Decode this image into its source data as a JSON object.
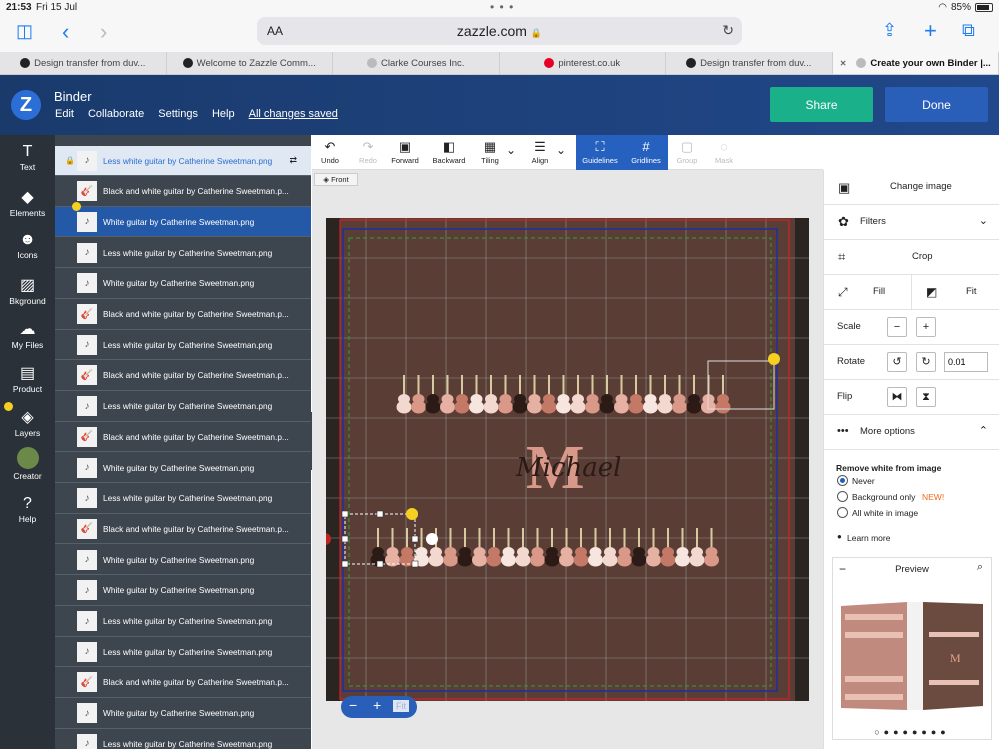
{
  "status": {
    "time": "21:53",
    "date": "Fri 15 Jul",
    "battery": "85%"
  },
  "browser": {
    "aa": "AA",
    "host": "zazzle.com",
    "lock": "🔒"
  },
  "tabs": [
    {
      "label": "Design transfer from duv...",
      "color": "#222"
    },
    {
      "label": "Welcome to Zazzle Comm...",
      "color": "#222"
    },
    {
      "label": "Clarke Courses Inc.",
      "color": "#bbb"
    },
    {
      "label": "pinterest.co.uk",
      "color": "#e60023"
    },
    {
      "label": "Design transfer from duv...",
      "color": "#222"
    },
    {
      "label": "Create your own Binder |...",
      "color": "#bbb"
    }
  ],
  "header": {
    "logo": "Z",
    "title": "Binder",
    "menu": [
      "Edit",
      "Collaborate",
      "Settings",
      "Help",
      "All changes saved"
    ],
    "share": "Share",
    "done": "Done"
  },
  "tools": [
    {
      "label": "Text",
      "icon": "text-icon",
      "glyph": "T"
    },
    {
      "label": "Elements",
      "icon": "elements-icon",
      "glyph": "◆"
    },
    {
      "label": "Icons",
      "icon": "smiley-icon",
      "glyph": "☻"
    },
    {
      "label": "Bkground",
      "icon": "background-icon",
      "glyph": "▨"
    },
    {
      "label": "My Files",
      "icon": "cloud-upload-icon",
      "glyph": "☁"
    },
    {
      "label": "Product",
      "icon": "product-icon",
      "glyph": "▤"
    },
    {
      "label": "Layers",
      "icon": "layers-icon",
      "glyph": "◈"
    },
    {
      "label": "Creator",
      "icon": "avatar",
      "glyph": "●"
    },
    {
      "label": "Help",
      "icon": "help-icon",
      "glyph": "?"
    }
  ],
  "layers": [
    "Less white guitar by Catherine Sweetman.png",
    "Black and white guitar by Catherine Sweetman.p...",
    "White guitar by Catherine Sweetman.png",
    "Less white guitar by Catherine Sweetman.png",
    "White guitar by Catherine Sweetman.png",
    "Black and white guitar by Catherine Sweetman.p...",
    "Less white guitar by Catherine Sweetman.png",
    "Black and white guitar by Catherine Sweetman.p...",
    "Less white guitar by Catherine Sweetman.png",
    "Black and white guitar by Catherine Sweetman.p...",
    "White guitar by Catherine Sweetman.png",
    "Less white guitar by Catherine Sweetman.png",
    "Black and white guitar by Catherine Sweetman.p...",
    "White guitar by Catherine Sweetman.png",
    "White guitar by Catherine Sweetman.png",
    "Less white guitar by Catherine Sweetman.png",
    "Less white guitar by Catherine Sweetman.png",
    "Black and white guitar by Catherine Sweetman.p...",
    "White guitar by Catherine Sweetman.png",
    "Less white guitar by Catherine Sweetman.png"
  ],
  "toolbar": [
    {
      "label": "Undo",
      "glyph": "↶"
    },
    {
      "label": "Redo",
      "glyph": "↷"
    },
    {
      "label": "Forward",
      "glyph": "▣"
    },
    {
      "label": "Backward",
      "glyph": "◧"
    },
    {
      "label": "Tiling",
      "glyph": "▦"
    },
    {
      "label": "Align",
      "glyph": "☰"
    },
    {
      "label": "Guidelines",
      "glyph": "⛶"
    },
    {
      "label": "Gridlines",
      "glyph": "#"
    },
    {
      "label": "Group",
      "glyph": "▢"
    },
    {
      "label": "Mask",
      "glyph": "◌"
    }
  ],
  "front": "Front",
  "design": {
    "monogram": "M",
    "name": "Michael",
    "bg": "#5a3e35"
  },
  "zoom": {
    "minus": "−",
    "plus": "+",
    "fit": "Fit"
  },
  "panel": {
    "change_image": "Change image",
    "filters": "Filters",
    "crop": "Crop",
    "fill": "Fill",
    "fit": "Fit",
    "scale": "Scale",
    "rotate": "Rotate",
    "rotate_value": "0.01",
    "flip": "Flip",
    "more": "More options",
    "remove_white": "Remove white from image",
    "options": [
      "Never",
      "Background only",
      "All white in image"
    ],
    "new_badge": "NEW!",
    "learn_more": "Learn more",
    "preview": "Preview"
  }
}
